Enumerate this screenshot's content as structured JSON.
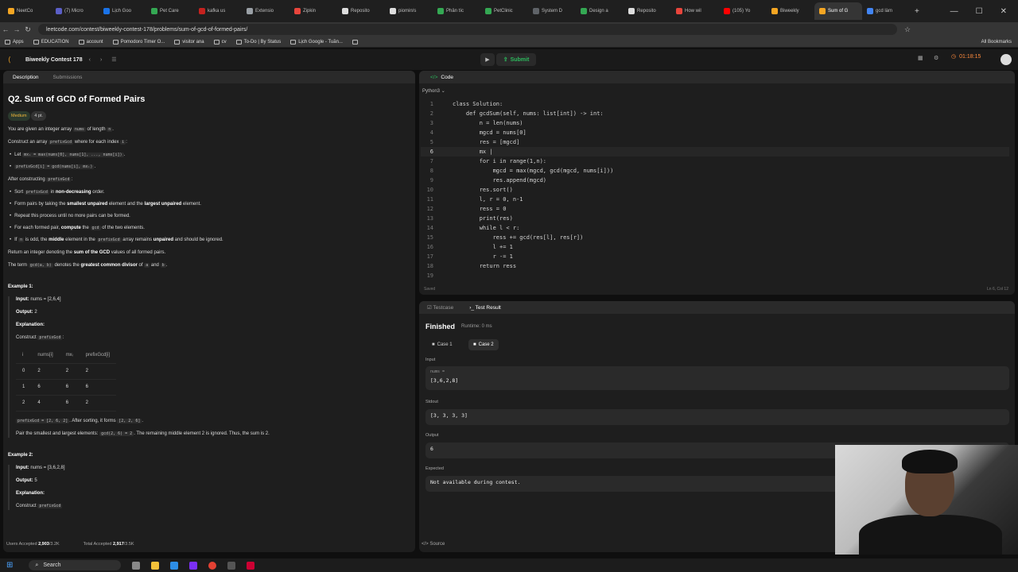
{
  "browser": {
    "tabs": [
      {
        "label": "NeetCo",
        "color": "#f5a623"
      },
      {
        "label": "(7) Micro",
        "color": "#5b5fc7"
      },
      {
        "label": "Lịch Goo",
        "color": "#1a73e8"
      },
      {
        "label": "Pet Care",
        "color": "#34a853"
      },
      {
        "label": "kafka us",
        "color": "#c5221f"
      },
      {
        "label": "Extensio",
        "color": "#9aa0a6"
      },
      {
        "label": "Zipkin",
        "color": "#e8453c"
      },
      {
        "label": "Reposito",
        "color": "#dddddd"
      },
      {
        "label": "piomin/s",
        "color": "#dddddd"
      },
      {
        "label": "Phân tíc",
        "color": "#34a853"
      },
      {
        "label": "PetClinic",
        "color": "#34a853"
      },
      {
        "label": "System D",
        "color": "#5f6368"
      },
      {
        "label": "Design a",
        "color": "#34a853"
      },
      {
        "label": "Reposito",
        "color": "#dddddd"
      },
      {
        "label": "How wil",
        "color": "#e8453c"
      },
      {
        "label": "(105) Yo",
        "color": "#ff0000"
      },
      {
        "label": "Biweekly",
        "color": "#f5a623"
      },
      {
        "label": "Sum of G",
        "color": "#f5a623"
      },
      {
        "label": "gcd làm",
        "color": "#4285f4"
      }
    ],
    "active_tab_index": 17,
    "url": "leetcode.com/contest/biweekly-contest-178/problems/sum-of-gcd-of-formed-pairs/",
    "bookmarks": [
      "Apps",
      "EDUCATION",
      "account",
      "Pomodoro Timer O...",
      "visitor ana",
      "cv",
      "To-Do | By Status",
      "Lịch Google - Tuần...",
      ""
    ],
    "all_bookmarks": "All Bookmarks"
  },
  "lcnav": {
    "contest": "Biweekly Contest 178",
    "submit": "Submit",
    "timer": "01:18:15"
  },
  "left": {
    "tab_description": "Description",
    "tab_submissions": "Submissions",
    "title": "Q2. Sum of GCD of Formed Pairs",
    "difficulty": "Medium",
    "points": "4 pt.",
    "p1a": "You are given an integer array ",
    "p1code": "nums",
    "p1b": " of length ",
    "p1code2": "n",
    "p1c": ".",
    "p2a": "Construct an array ",
    "p2code": "prefixGcd",
    "p2b": " where for each index ",
    "p2code2": "i",
    "p2c": ":",
    "b1a": "Let ",
    "b1code": "mxᵢ = max(nums[0], nums[1], ..., nums[i])",
    "b1b": ".",
    "b2code": "prefixGcd[i] = gcd(nums[i], mxᵢ)",
    "b2b": ".",
    "p3a": "After constructing ",
    "p3code": "prefixGcd",
    "p3b": ":",
    "s1a": "Sort ",
    "s1code": "prefixGcd",
    "s1b": " in ",
    "s1bold": "non-decreasing",
    "s1c": " order.",
    "s2a": "Form pairs by taking the ",
    "s2bold": "smallest unpaired",
    "s2b": " element and the ",
    "s2bold2": "largest unpaired",
    "s2c": " element.",
    "s3": "Repeat this process until no more pairs can be formed.",
    "s4a": "For each formed pair, ",
    "s4bold": "compute",
    "s4b": " the ",
    "s4code": "gcd",
    "s4c": " of the two elements.",
    "s5a": "If ",
    "s5code": "n",
    "s5b": " is odd, the ",
    "s5bold": "middle",
    "s5c": " element in the ",
    "s5code2": "prefixGcd",
    "s5d": " array remains ",
    "s5bold2": "unpaired",
    "s5e": " and should be ignored.",
    "p4a": "Return an integer denoting the ",
    "p4bold": "sum of the GCD",
    "p4b": " values of all formed pairs.",
    "p5a": "The term ",
    "p5code": "gcd(a, b)",
    "p5b": " denotes the ",
    "p5bold": "greatest common divisor",
    "p5c": " of ",
    "p5code2": "a",
    "p5d": " and ",
    "p5code3": "b",
    "p5e": ".",
    "ex1_title": "Example 1:",
    "ex1_input_label": "Input:",
    "ex1_input": "nums = [2,6,4]",
    "ex1_output_label": "Output:",
    "ex1_output": "2",
    "ex1_expl_label": "Explanation:",
    "ex1_construct": "Construct ",
    "ex1_construct_code": "prefixGcd",
    "ex1_construct_end": ":",
    "table_headers": [
      "i",
      "nums[i]",
      "mxᵢ",
      "prefixGcd[i]"
    ],
    "table_rows": [
      [
        "0",
        "2",
        "2",
        "2"
      ],
      [
        "1",
        "6",
        "6",
        "6"
      ],
      [
        "2",
        "4",
        "6",
        "2"
      ]
    ],
    "ex1_after_code": "prefixGcd = [2, 6, 2]",
    "ex1_after_a": ". After sorting, it forms ",
    "ex1_after_code2": "[2, 2, 6]",
    "ex1_after_b": ".",
    "ex1_pair_a": "Pair the smallest and largest elements: ",
    "ex1_pair_code": "gcd(2, 6) = 2",
    "ex1_pair_b": ". The remaining middle element 2 is ignored. Thus, the sum is 2.",
    "ex2_title": "Example 2:",
    "ex2_input": "nums = [3,6,2,8]",
    "ex2_output": "5",
    "ex2_construct_partial": "Construct ",
    "ex2_construct_code": "prefixGcd",
    "users_accepted_label": "Users Accepted",
    "users_accepted": "2,903",
    "users_total": "/3.2K",
    "total_accepted_label": "Total Accepted",
    "total_accepted": "2,917",
    "total_total": "/3.5K"
  },
  "code": {
    "header": "Code",
    "language": "Python3",
    "status": "Saved",
    "position": "Ln 6, Col 12",
    "lines": [
      "class Solution:",
      "    def gcdSum(self, nums: list[int]) -> int:",
      "        n = len(nums)",
      "        mgcd = nums[0]",
      "        res = [mgcd]",
      "        mx |",
      "        for i in range(1,n):",
      "            mgcd = max(mgcd, gcd(mgcd, nums[i]))",
      "            res.append(mgcd)",
      "        res.sort()",
      "        l, r = 0, n-1",
      "        ress = 0",
      "        print(res)",
      "        while l < r:",
      "            ress += gcd(res[l], res[r])",
      "            l += 1",
      "            r -= 1",
      "        return ress",
      ""
    ],
    "current_line": 6
  },
  "result": {
    "tab_testcase": "Testcase",
    "tab_result": "Test Result",
    "status": "Finished",
    "runtime": "Runtime: 0 ms",
    "case1": "Case 1",
    "case2": "Case 2",
    "input_label": "Input",
    "input_var": "nums =",
    "input_value": "[3,6,2,8]",
    "stdout_label": "Stdout",
    "stdout_value": "[3, 3, 3, 3]",
    "output_label": "Output",
    "output_value": "6",
    "expected_label": "Expected",
    "expected_value": "Not available during contest."
  },
  "source": "Source",
  "taskbar": {
    "search": "Search"
  },
  "colors": {
    "accent_green": "#2cbb5d",
    "medium": "#f5b83a",
    "timer": "#ff8b3d"
  }
}
